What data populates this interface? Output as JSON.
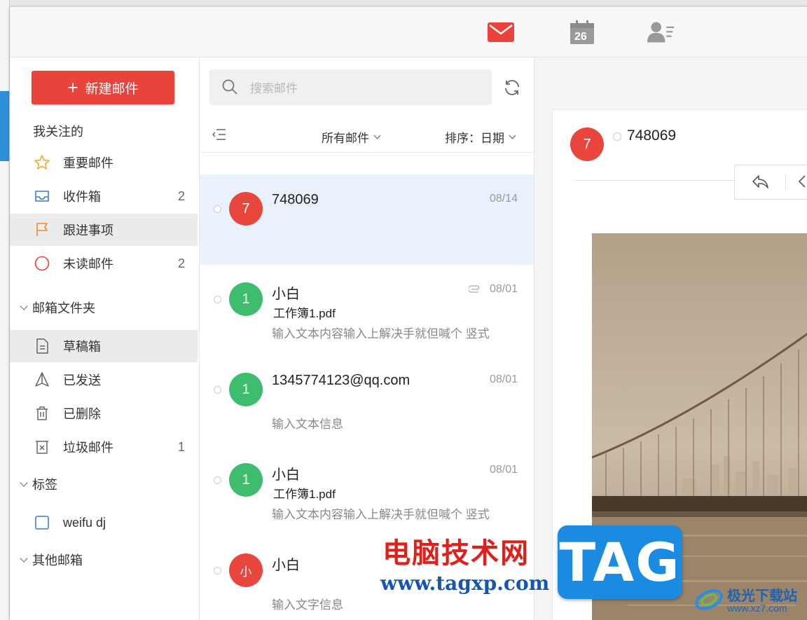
{
  "topbar": {
    "icons": [
      "mail-icon",
      "calendar-icon",
      "contacts-icon"
    ],
    "calendar_day": "26",
    "accent": "#e9433c"
  },
  "sidebar": {
    "compose_label": "新建邮件",
    "followed_title": "我关注的",
    "followed": [
      {
        "label": "重要邮件",
        "count": "",
        "icon": "star-icon"
      },
      {
        "label": "收件箱",
        "count": "2",
        "icon": "inbox-icon"
      },
      {
        "label": "跟进事项",
        "count": "",
        "icon": "flag-icon"
      },
      {
        "label": "未读邮件",
        "count": "2",
        "icon": "unread-circle-icon"
      }
    ],
    "folders_title": "邮箱文件夹",
    "folders": [
      {
        "label": "草稿箱",
        "count": "",
        "icon": "draft-icon"
      },
      {
        "label": "已发送",
        "count": "",
        "icon": "sent-icon"
      },
      {
        "label": "已删除",
        "count": "",
        "icon": "trash-icon"
      },
      {
        "label": "垃圾邮件",
        "count": "1",
        "icon": "spam-icon"
      }
    ],
    "tags_title": "标签",
    "tags": [
      {
        "label": "weifu dj",
        "icon": "checkbox-icon"
      }
    ],
    "other_title": "其他邮箱"
  },
  "list": {
    "search_placeholder": "搜索邮件",
    "filter_label": "所有邮件",
    "sort_label": "排序：日期",
    "mails": [
      {
        "avatar": "7",
        "avatar_color": "#e9473e",
        "sender": "748069",
        "date": "08/14",
        "subject": "",
        "preview": "",
        "attachment": false
      },
      {
        "avatar": "1",
        "avatar_color": "#3dbd6d",
        "sender": "小白",
        "date": "08/01",
        "subject": "工作簿1.pdf",
        "preview": "输入文本内容输入上解决手就但喊个 竖式",
        "attachment": true
      },
      {
        "avatar": "1",
        "avatar_color": "#3dbd6d",
        "sender": "1345774123@qq.com",
        "date": "08/01",
        "subject": "",
        "preview": "输入文本信息",
        "attachment": false
      },
      {
        "avatar": "1",
        "avatar_color": "#3dbd6d",
        "sender": "小白",
        "date": "08/01",
        "subject": "工作簿1.pdf",
        "preview": "输入文本内容输入上解决手就但喊个 竖式",
        "attachment": false
      },
      {
        "avatar": "小",
        "avatar_color": "#e9473e",
        "sender": "小白",
        "date": "",
        "subject": "",
        "preview": "输入文字信息",
        "attachment": false
      }
    ]
  },
  "reader": {
    "avatar": "7",
    "sender": "748069"
  },
  "watermark": {
    "cn": "电脑技术网",
    "url": "www.tagxp.com",
    "tag": "TAG",
    "site_name": "极光下载站",
    "site_url": "www.xz7.com"
  }
}
